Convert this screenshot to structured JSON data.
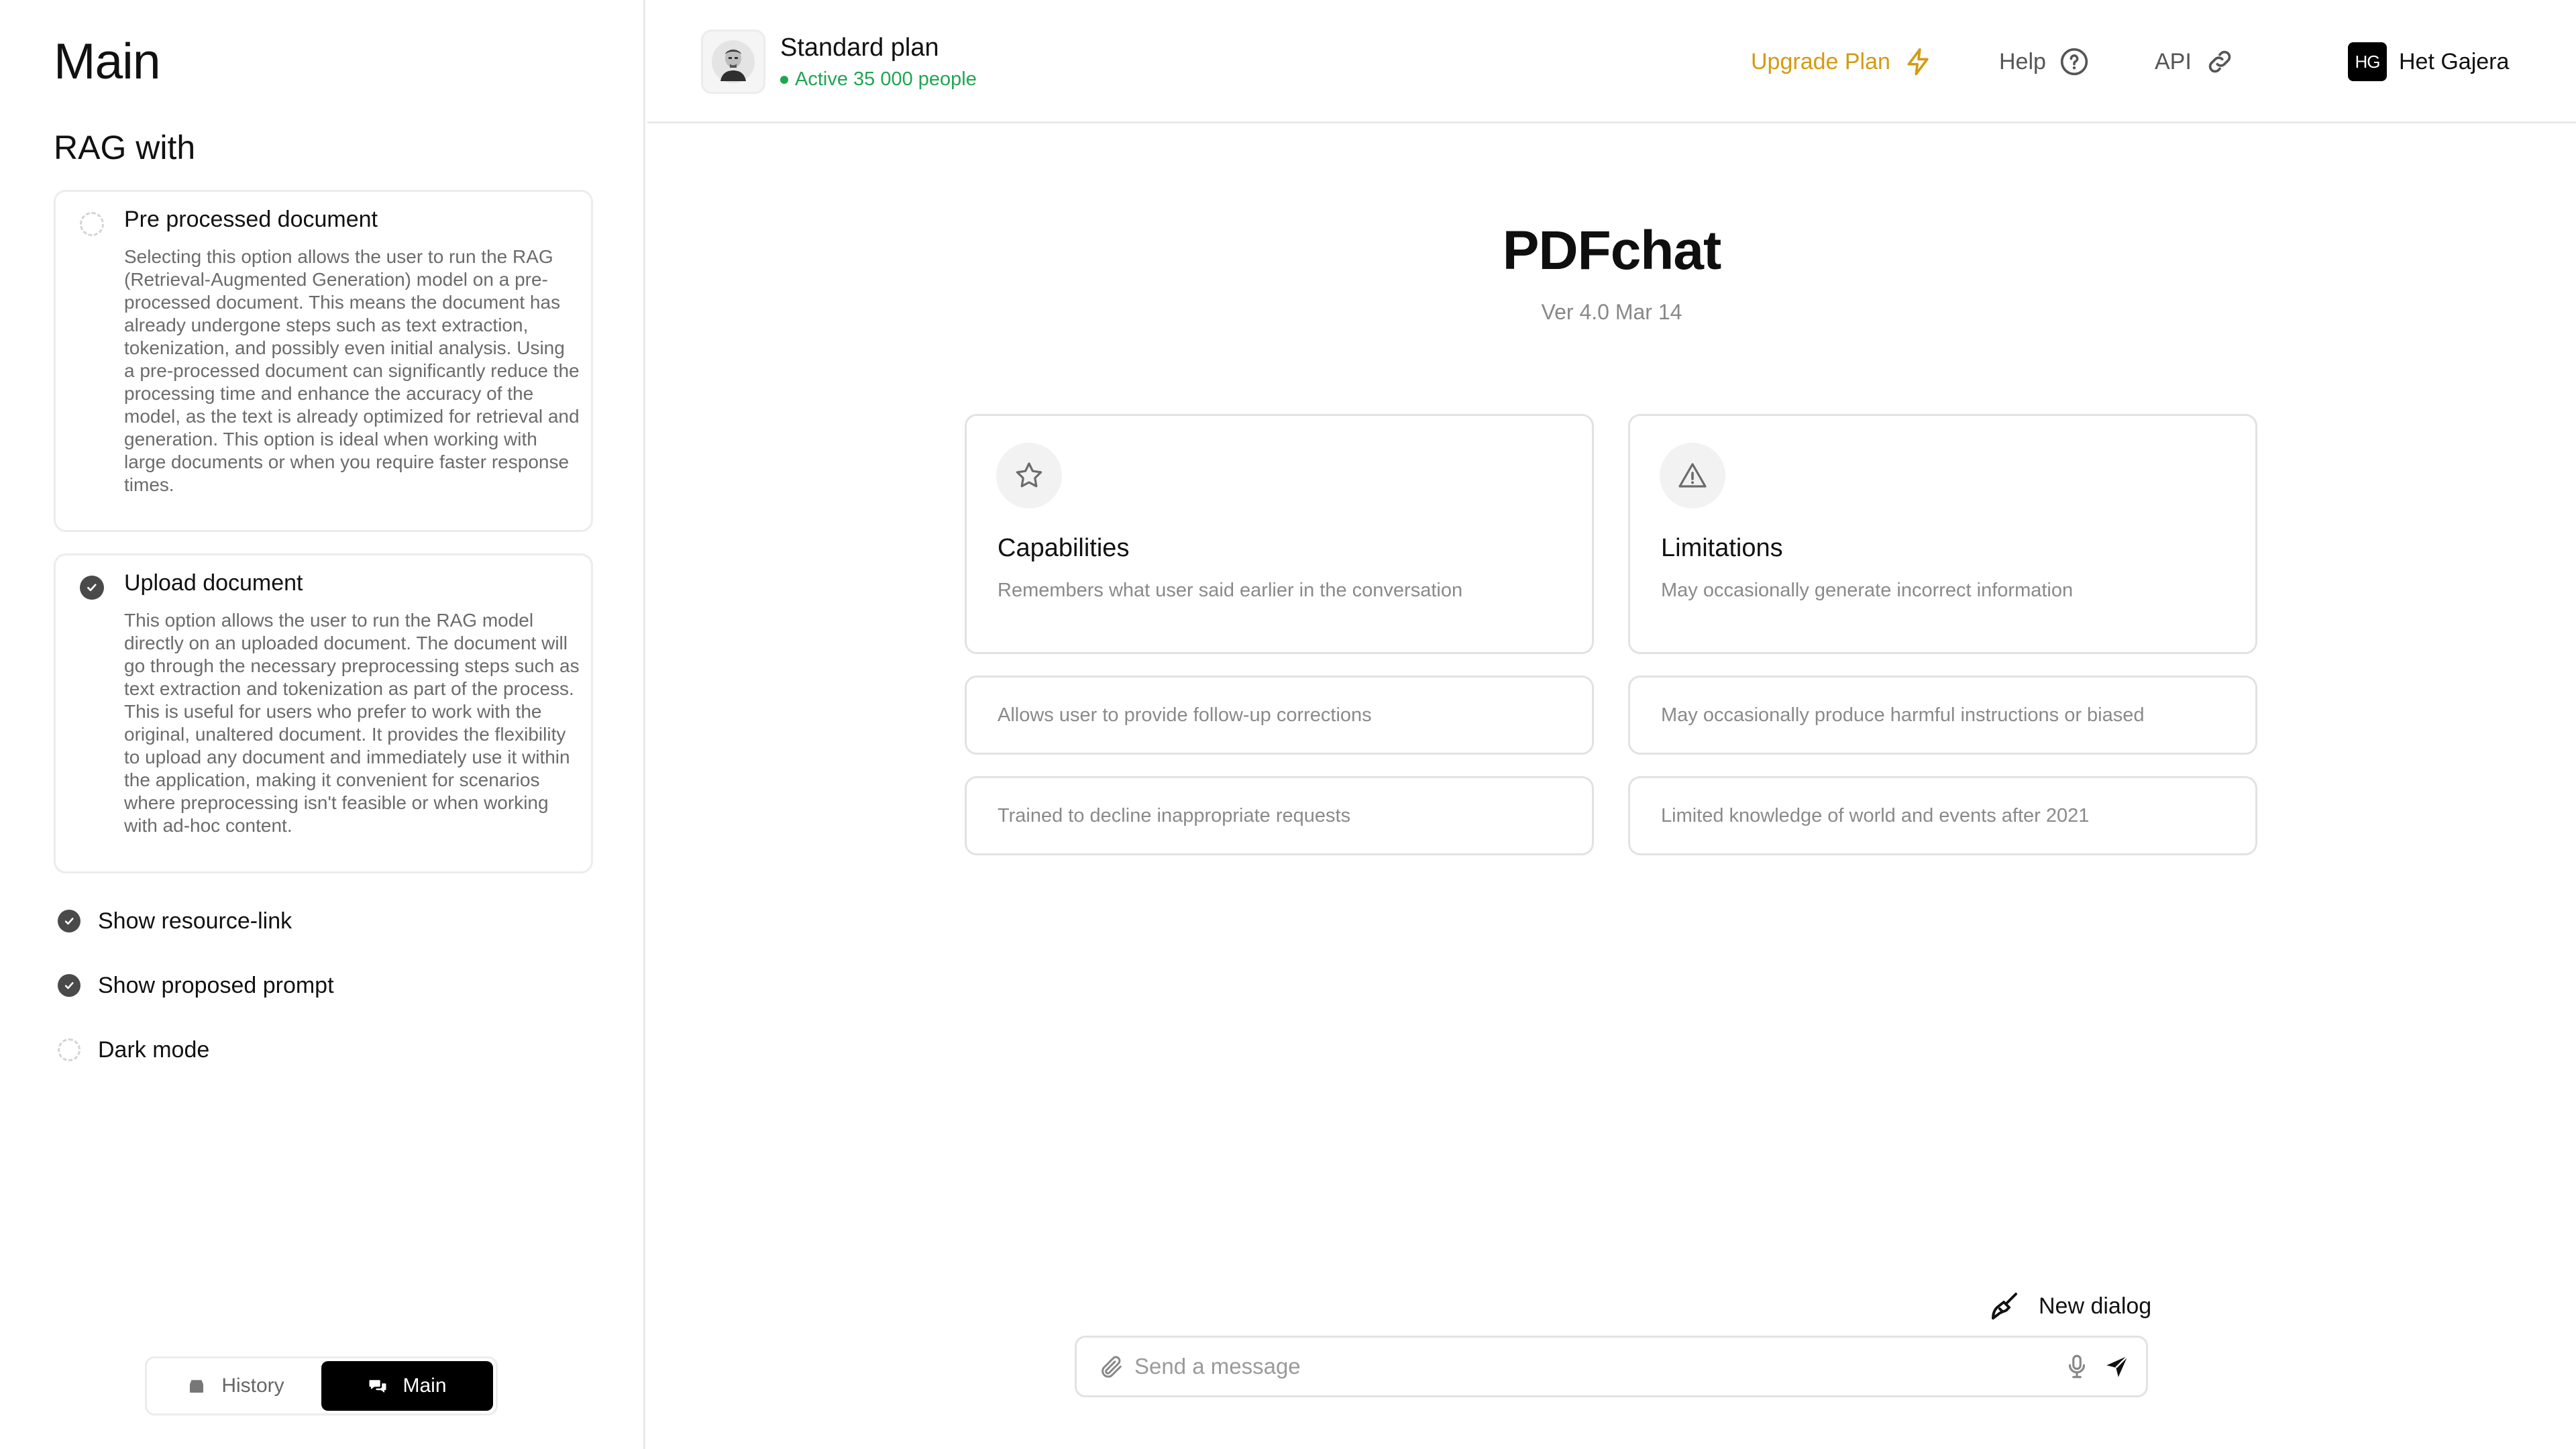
{
  "sidebar": {
    "title": "Main",
    "subtitle": "RAG with",
    "options": [
      {
        "title": "Pre processed document",
        "description": "Selecting this option allows the user to run the RAG (Retrieval-Augmented Generation) model on a pre-processed document. This means the document has already undergone steps such as text extraction, tokenization, and possibly even initial analysis. Using a pre-processed document can significantly reduce the processing time and enhance the accuracy of the model, as the text is already optimized for retrieval and generation. This option is ideal when working with large documents or when you require faster response times.",
        "selected": false
      },
      {
        "title": "Upload document",
        "description": "This option allows the user to run the RAG model directly on an uploaded document. The document will go through the necessary preprocessing steps such as text extraction and tokenization as part of the process. This is useful for users who prefer to work with the original, unaltered document. It provides the flexibility to upload any document and immediately use it within the application, making it convenient for scenarios where preprocessing isn't feasible or when working with ad-hoc content.",
        "selected": true
      }
    ],
    "toggles": [
      {
        "label": "Show resource-link",
        "checked": true
      },
      {
        "label": "Show proposed prompt",
        "checked": true
      },
      {
        "label": "Dark mode",
        "checked": false
      }
    ],
    "segmented": {
      "history_label": "History",
      "main_label": "Main",
      "active": "main"
    }
  },
  "header": {
    "plan_name": "Standard plan",
    "plan_status": "Active 35 000 people",
    "upgrade_label": "Upgrade Plan",
    "help_label": "Help",
    "api_label": "API",
    "user_initials": "HG",
    "user_name": "Het Gajera"
  },
  "main": {
    "title": "PDFchat",
    "version": "Ver 4.0 Mar 14",
    "capabilities": {
      "icon": "star-icon",
      "title": "Capabilities",
      "items": [
        "Remembers what user said earlier in the conversation",
        "Allows user to provide follow-up corrections",
        "Trained to decline inappropriate requests"
      ]
    },
    "limitations": {
      "icon": "warning-icon",
      "title": "Limitations",
      "items": [
        "May occasionally generate incorrect information",
        "May occasionally produce harmful instructions or biased",
        "Limited knowledge of world and events after 2021"
      ]
    },
    "new_dialog_label": "New dialog",
    "composer": {
      "placeholder": "Send a message",
      "value": ""
    }
  },
  "colors": {
    "accent": "#000000",
    "upgrade": "#d49a12",
    "status_green": "#1fa650",
    "muted_text": "#8a8a8a",
    "border": "#e2e2e2"
  }
}
